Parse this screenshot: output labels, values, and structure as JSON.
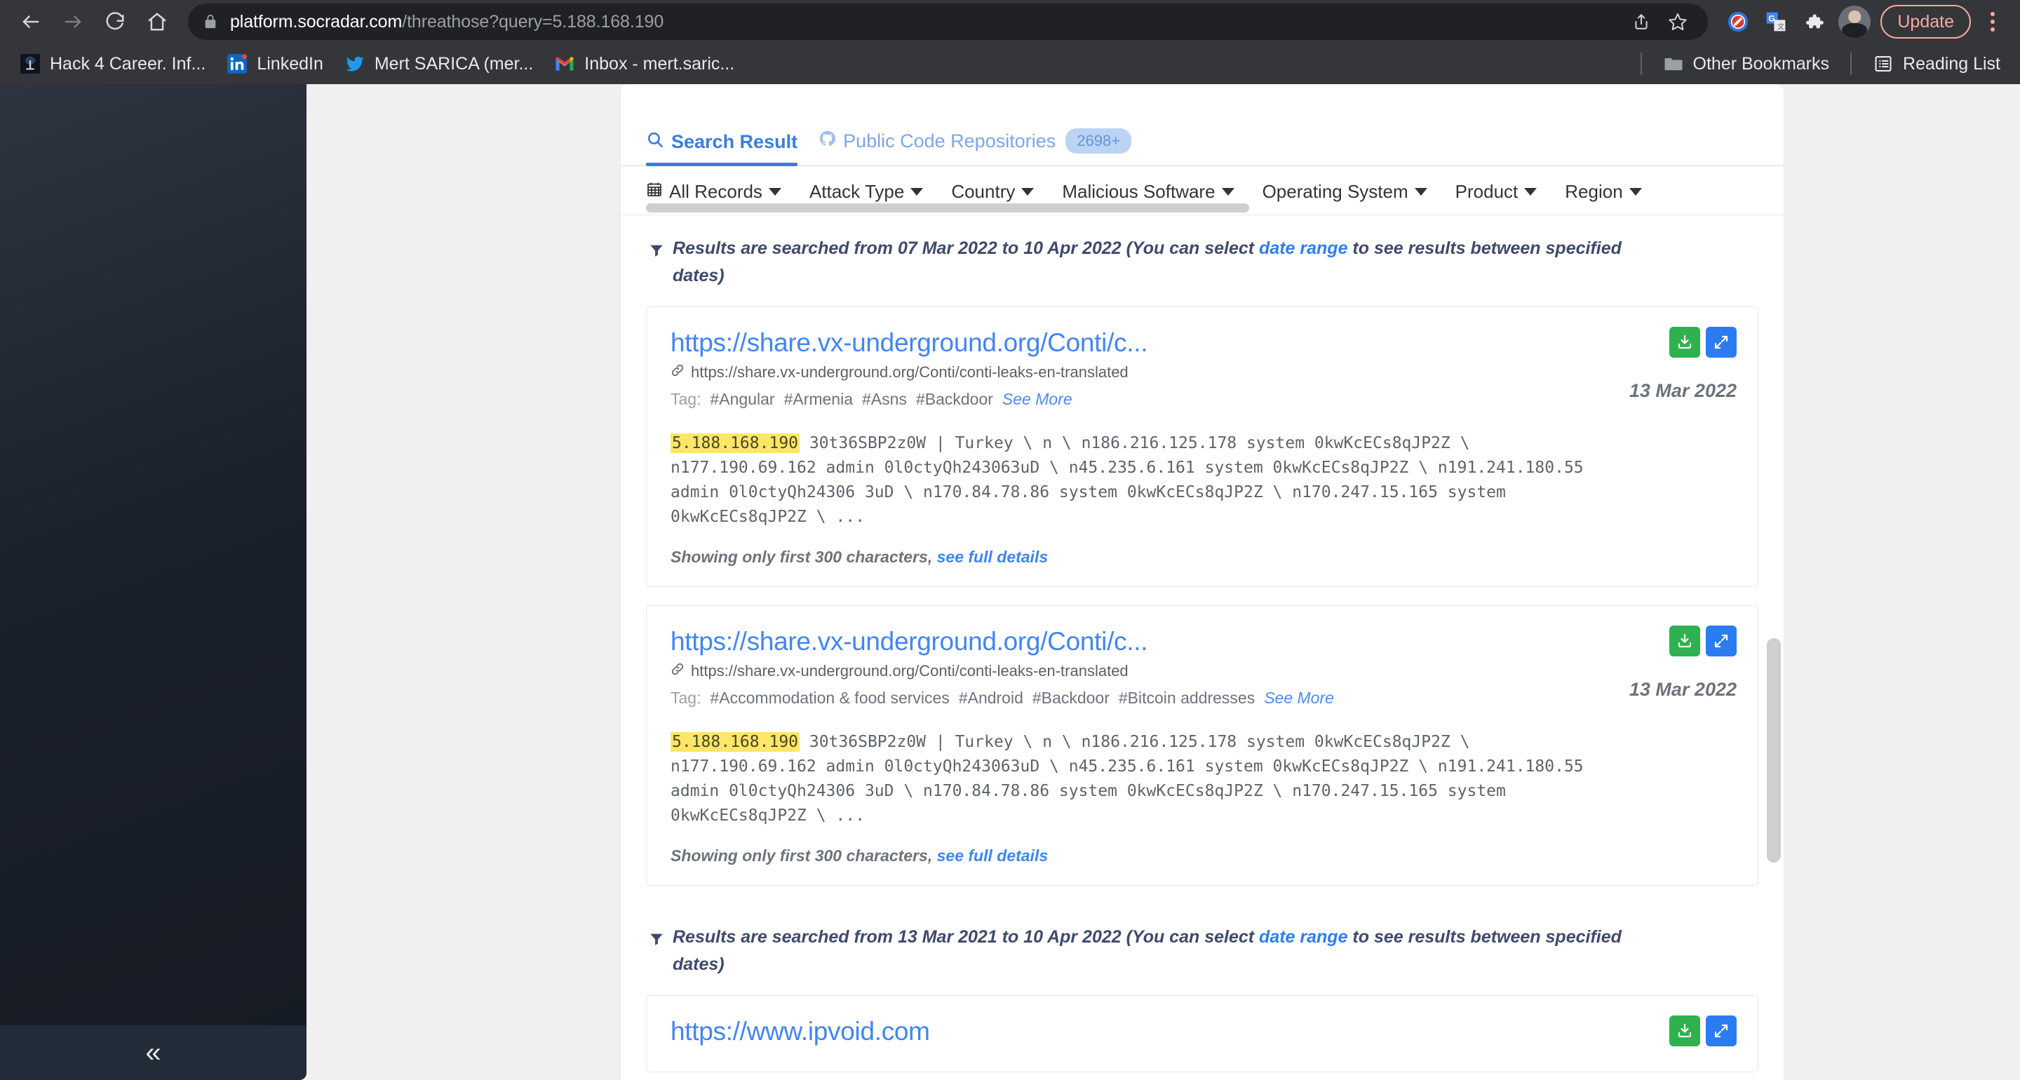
{
  "browser": {
    "nav": {
      "back": "back-arrow",
      "forward": "forward-arrow",
      "reload": "reload",
      "home": "home"
    },
    "omnibox": {
      "lock_icon": "lock-icon",
      "url_host": "platform.socradar.com",
      "url_path": "/threathose?query=5.188.168.190",
      "share_icon": "share-icon",
      "bookmark_icon": "star-icon"
    },
    "extensions": [
      {
        "name": "adblock-extension-icon",
        "label": "AdBlock"
      },
      {
        "name": "google-translate-extension-icon",
        "label": "Google Translate"
      },
      {
        "name": "extensions-puzzle-icon",
        "label": "Extensions"
      }
    ],
    "profile": {
      "name": "avatar",
      "label": "Profile"
    },
    "update_label": "Update",
    "menu_label": "Customize and control Google Chrome"
  },
  "bookmarks": {
    "items": [
      {
        "label": "Hack 4 Career. Inf...",
        "icon": "site-favicon"
      },
      {
        "label": "LinkedIn",
        "icon": "linkedin-favicon"
      },
      {
        "label": "Mert SARICA (mer...",
        "icon": "twitter-favicon"
      },
      {
        "label": "Inbox - mert.saric...",
        "icon": "gmail-favicon"
      }
    ],
    "other_bookmarks": "Other Bookmarks",
    "reading_list": "Reading List"
  },
  "sidebar": {
    "collapse_label": "«"
  },
  "tabs": [
    {
      "label": "Search Result",
      "icon": "search-icon",
      "active": true,
      "badge": null
    },
    {
      "label": "Public Code Repositories",
      "icon": "github-icon",
      "active": false,
      "badge": "2698+"
    }
  ],
  "filters": [
    {
      "label": "All Records",
      "icon": "calendar-icon",
      "caret": true
    },
    {
      "label": "Attack Type",
      "icon": null,
      "caret": true
    },
    {
      "label": "Country",
      "icon": null,
      "caret": true
    },
    {
      "label": "Malicious Software",
      "icon": null,
      "caret": true
    },
    {
      "label": "Operating System",
      "icon": null,
      "caret": true
    },
    {
      "label": "Product",
      "icon": null,
      "caret": true
    },
    {
      "label": "Region",
      "icon": null,
      "caret": true
    }
  ],
  "sections": [
    {
      "note": {
        "prefix": "Results are searched from 07 Mar 2022 to 10 Apr 2022 (You can select ",
        "link": "date range",
        "suffix": " to see results between specified dates)"
      },
      "cards": [
        {
          "title": "https://share.vx-underground.org/Conti/c...",
          "url": "https://share.vx-underground.org/Conti/conti-leaks-en-translated",
          "tag_label": "Tag:",
          "tags": [
            "#Angular",
            "#Armenia",
            "#Asns",
            "#Backdoor"
          ],
          "see_more": "See More",
          "date": "13 Mar 2022",
          "highlight": "5.188.168.190",
          "snippet": " 30t36SBP2z0W | Turkey \\ n \\ n186.216.125.178 system 0kwKcECs8qJP2Z \\ n177.190.69.162 admin 0l0ctyQh243063uD \\ n45.235.6.161 system 0kwKcECs8qJP2Z \\ n191.241.180.55 admin 0l0ctyQh24306 3uD \\ n170.84.78.86 system 0kwKcECs8qJP2Z \\ n170.247.15.165 system 0kwKcECs8qJP2Z \\  ...",
          "footer_text": "Showing only first 300 characters, ",
          "footer_link": "see full details",
          "download_icon": "download-icon",
          "expand_icon": "expand-icon"
        },
        {
          "title": "https://share.vx-underground.org/Conti/c...",
          "url": "https://share.vx-underground.org/Conti/conti-leaks-en-translated",
          "tag_label": "Tag:",
          "tags": [
            "#Accommodation & food services",
            "#Android",
            "#Backdoor",
            "#Bitcoin addresses"
          ],
          "see_more": "See More",
          "date": "13 Mar 2022",
          "highlight": "5.188.168.190",
          "snippet": " 30t36SBP2z0W | Turkey \\ n \\ n186.216.125.178 system 0kwKcECs8qJP2Z \\ n177.190.69.162 admin 0l0ctyQh243063uD \\ n45.235.6.161 system 0kwKcECs8qJP2Z \\ n191.241.180.55 admin 0l0ctyQh24306 3uD \\ n170.84.78.86 system 0kwKcECs8qJP2Z \\ n170.247.15.165 system 0kwKcECs8qJP2Z \\  ...",
          "footer_text": "Showing only first 300 characters, ",
          "footer_link": "see full details",
          "download_icon": "download-icon",
          "expand_icon": "expand-icon"
        }
      ]
    },
    {
      "note": {
        "prefix": "Results are searched from 13 Mar 2021 to 10 Apr 2022 (You can select ",
        "link": "date range",
        "suffix": " to see results between specified dates)"
      },
      "cards": [
        {
          "title": "https://www.ipvoid.com",
          "url": "",
          "tag_label": "",
          "tags": [],
          "see_more": "",
          "date": "",
          "highlight": "",
          "snippet": "",
          "footer_text": "",
          "footer_link": "",
          "download_icon": "download-icon",
          "expand_icon": "expand-icon"
        }
      ]
    }
  ],
  "colors": {
    "accent_blue": "#3b7ddd",
    "link_blue": "#4285f4",
    "download_green": "#2eb14e",
    "expand_blue": "#2b7cf0",
    "highlight_yellow": "#ffe66a",
    "update_pink": "#f6a9a0"
  }
}
